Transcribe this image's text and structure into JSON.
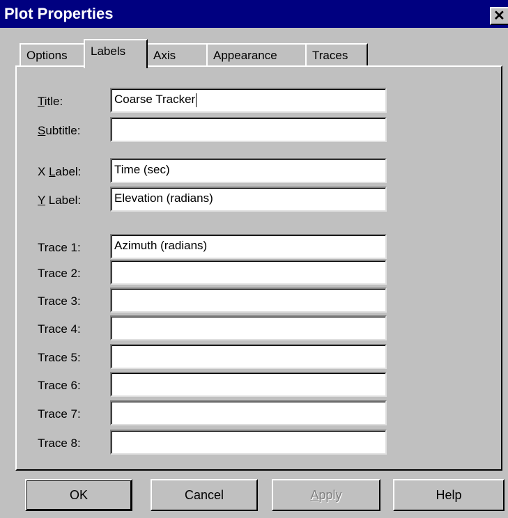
{
  "window": {
    "title": "Plot Properties",
    "close_glyph": "✕"
  },
  "tabs": [
    {
      "label": "Options"
    },
    {
      "label": "Labels"
    },
    {
      "label": "Axis"
    },
    {
      "label": "Appearance"
    },
    {
      "label": "Traces"
    }
  ],
  "active_tab": "Labels",
  "fields": {
    "title": {
      "label": "Title:",
      "value": "Coarse Tracker"
    },
    "subtitle": {
      "label": "Subtitle:",
      "value": ""
    },
    "xlabel": {
      "label": "X Label:",
      "value": "Time (sec)"
    },
    "ylabel": {
      "label": "Y Label:",
      "value": "Elevation (radians)"
    },
    "traces": [
      {
        "label": "Trace 1:",
        "value": "Azimuth (radians)"
      },
      {
        "label": "Trace 2:",
        "value": ""
      },
      {
        "label": "Trace 3:",
        "value": ""
      },
      {
        "label": "Trace 4:",
        "value": ""
      },
      {
        "label": "Trace 5:",
        "value": ""
      },
      {
        "label": "Trace 6:",
        "value": ""
      },
      {
        "label": "Trace 7:",
        "value": ""
      },
      {
        "label": "Trace 8:",
        "value": ""
      }
    ]
  },
  "buttons": {
    "ok": "OK",
    "cancel": "Cancel",
    "apply": "Apply",
    "help": "Help"
  }
}
